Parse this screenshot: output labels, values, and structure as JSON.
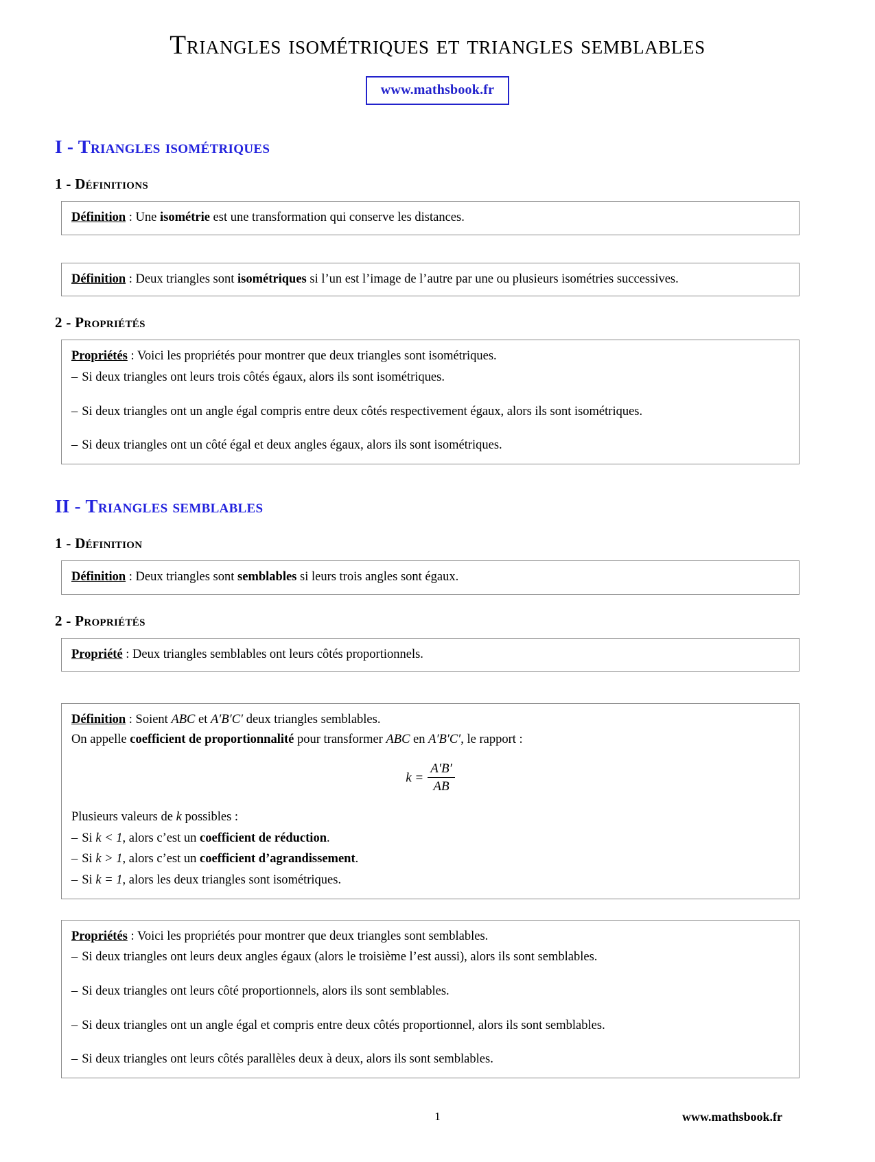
{
  "document": {
    "title": "Triangles isométriques et triangles semblables",
    "url_badge": "www.mathsbook.fr"
  },
  "section1": {
    "heading": "I - Triangles isométriques",
    "sub1": {
      "heading": "1 - Définitions",
      "box1": {
        "lead": "Définition",
        "sep": " : ",
        "text_a": "Une ",
        "keyword": "isométrie",
        "text_b": " est une transformation qui conserve les distances."
      },
      "box2": {
        "lead": "Définition",
        "sep": " : ",
        "text_a": "Deux triangles sont ",
        "keyword": "isométriques",
        "text_b": " si l’un est l’image de l’autre par une ou plusieurs isométries successives."
      }
    },
    "sub2": {
      "heading": "2 - Propriétés",
      "box": {
        "lead": "Propriétés",
        "sep": " : ",
        "intro": "Voici les propriétés pour montrer que deux triangles sont isométriques.",
        "items": [
          "Si deux triangles ont leurs trois côtés égaux, alors ils sont isométriques.",
          "Si deux triangles ont un angle égal compris entre deux côtés respectivement égaux, alors ils sont isométriques.",
          "Si deux triangles ont un côté égal et deux angles égaux, alors ils sont isométriques."
        ]
      }
    }
  },
  "section2": {
    "heading": "II - Triangles semblables",
    "sub1": {
      "heading": "1 - Définition",
      "box": {
        "lead": "Définition",
        "sep": " : ",
        "text_a": "Deux triangles sont ",
        "keyword": "semblables",
        "text_b": " si leurs trois angles sont égaux."
      }
    },
    "sub2": {
      "heading": "2 - Propriétés",
      "box_prop": {
        "lead": "Propriété",
        "sep": " : ",
        "text": "Deux triangles semblables ont leurs côtés proportionnels."
      },
      "box_def": {
        "lead": "Définition",
        "sep": " : ",
        "line1_a": "Soient ",
        "line1_m1": "ABC",
        "line1_b": " et ",
        "line1_m2": "A′B′C′",
        "line1_c": " deux triangles semblables.",
        "line2_a": "On appelle ",
        "line2_kw": "coefficient de proportionnalité",
        "line2_b": " pour transformer ",
        "line2_m1": "ABC",
        "line2_c": " en ",
        "line2_m2": "A′B′C′",
        "line2_d": ", le rapport :",
        "formula": {
          "lhs": "k =",
          "numerator": "A′B′",
          "denominator": "AB"
        },
        "values_intro_a": "Plusieurs valeurs de ",
        "values_intro_k": "k",
        "values_intro_b": " possibles :",
        "cases": [
          {
            "cond_a": "Si ",
            "cond_m": "k < 1",
            "cond_b": ", alors c’est un ",
            "kw": "coefficient de réduction",
            "tail": "."
          },
          {
            "cond_a": "Si ",
            "cond_m": "k > 1",
            "cond_b": ", alors c’est un ",
            "kw": "coefficient d’agrandissement",
            "tail": "."
          },
          {
            "cond_a": "Si ",
            "cond_m": "k = 1",
            "cond_b": ", alors les deux triangles sont isométriques.",
            "kw": "",
            "tail": ""
          }
        ]
      },
      "box_props": {
        "lead": "Propriétés",
        "sep": " : ",
        "intro": "Voici les propriétés pour montrer que deux triangles sont semblables.",
        "items": [
          "Si deux triangles ont leurs deux angles égaux (alors le troisième l’est aussi), alors ils sont semblables.",
          "Si deux triangles ont leurs côté proportionnels, alors ils sont semblables.",
          "Si deux triangles ont un angle égal et compris entre deux côtés proportionnel, alors ils sont semblables.",
          "Si deux triangles ont leurs côtés parallèles deux à deux, alors ils sont semblables."
        ]
      }
    }
  },
  "footer": {
    "page_number": "1",
    "url": "www.mathsbook.fr"
  },
  "colors": {
    "heading_blue": "#2222dd",
    "badge_blue": "#2222cc",
    "box_border": "#8a8a8a",
    "text": "#000000"
  },
  "symbols": {
    "dash": "–"
  }
}
